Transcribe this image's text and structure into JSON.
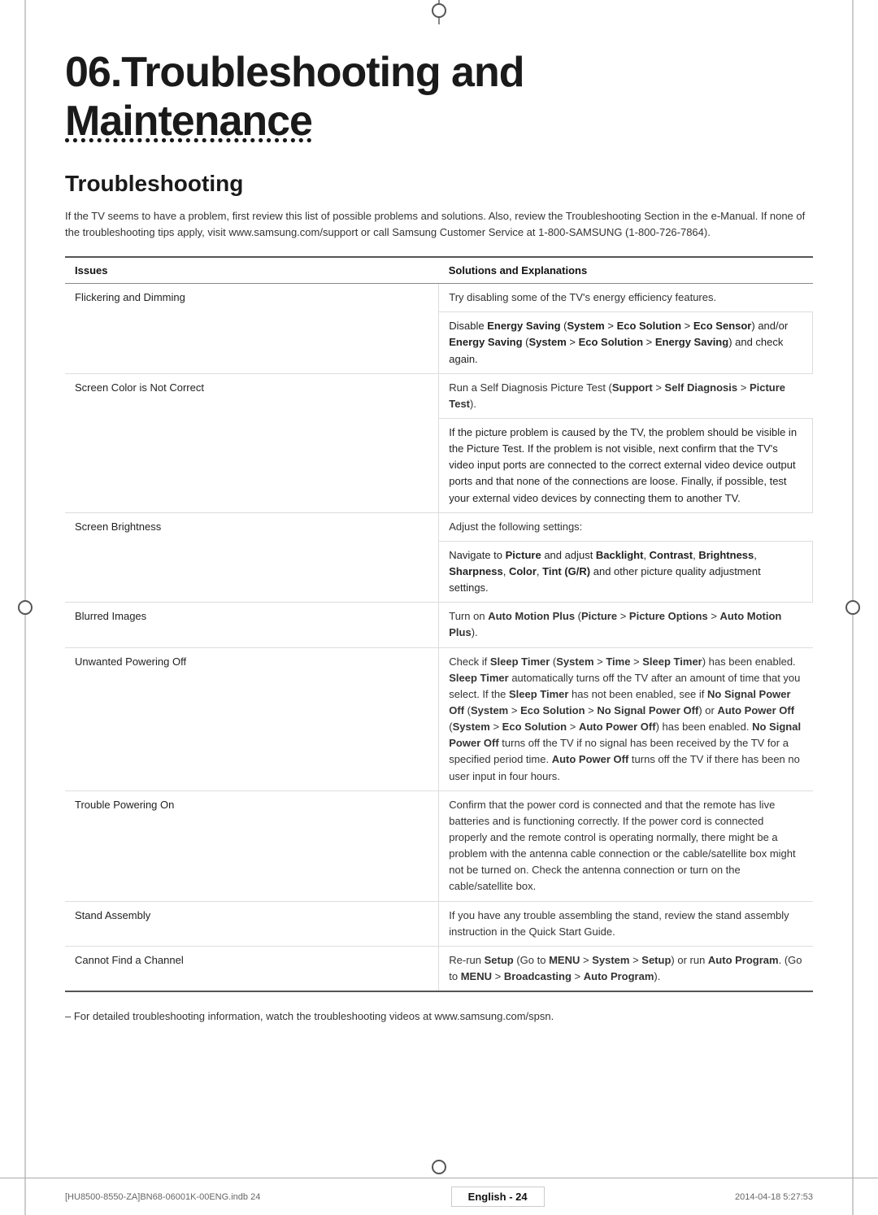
{
  "page": {
    "top_decoration": "circle",
    "left_decoration": "circle",
    "right_decoration": "circle",
    "bottom_decoration": "circle"
  },
  "header": {
    "chapter_number": "06.",
    "title_line1": "Troubleshooting and",
    "title_line2": "Maintenance"
  },
  "section": {
    "title": "Troubleshooting",
    "intro": "If the TV seems to have a problem, first review this list of possible problems and solutions. Also, review the Troubleshooting Section in the e-Manual. If none of the troubleshooting tips apply, visit www.samsung.com/support or call Samsung Customer Service at 1-800-SAMSUNG (1-800-726-7864)."
  },
  "table": {
    "col_issues": "Issues",
    "col_solutions": "Solutions and Explanations",
    "rows": [
      {
        "issue": "Flickering and Dimming",
        "solutions": [
          "Try disabling some of the TV's energy efficiency features.",
          "Disable Energy Saving (System > Eco Solution > Eco Sensor) and/or Energy Saving (System > Eco Solution > Energy Saving) and check again."
        ]
      },
      {
        "issue": "Screen Color is Not Correct",
        "solutions": [
          "Run a Self Diagnosis Picture Test (Support > Self Diagnosis > Picture Test).",
          "If the picture problem is caused by the TV, the problem should be visible in the Picture Test. If the problem is not visible, next confirm that the TV's video input ports are connected to the correct external video device output ports and that none of the connections are loose. Finally, if possible, test your external video devices by connecting them to another TV."
        ]
      },
      {
        "issue": "Screen Brightness",
        "solutions": [
          "Adjust the following settings:",
          "Navigate to Picture and adjust Backlight, Contrast, Brightness, Sharpness, Color, Tint (G/R) and other picture quality adjustment settings."
        ]
      },
      {
        "issue": "Blurred Images",
        "solutions": [
          "Turn on Auto Motion Plus (Picture > Picture Options > Auto Motion Plus)."
        ]
      },
      {
        "issue": "Unwanted Powering Off",
        "solutions": [
          "Check if Sleep Timer (System > Time > Sleep Timer) has been enabled. Sleep Timer automatically turns off the TV after an amount of time that you select. If the Sleep Timer has not been enabled, see if No Signal Power Off (System > Eco Solution > No Signal Power Off) or Auto Power Off (System > Eco Solution > Auto Power Off) has been enabled. No Signal Power Off turns off the TV if no signal has been received by the TV for a specified period time. Auto Power Off turns off the TV if there has been no user input in four hours."
        ]
      },
      {
        "issue": "Trouble Powering On",
        "solutions": [
          "Confirm that the power cord is connected and that the remote has live batteries and is functioning correctly. If the power cord is connected properly and the remote control is operating normally, there might be a problem with the antenna cable connection or the cable/satellite box might not be turned on. Check the antenna connection or turn on the cable/satellite box."
        ]
      },
      {
        "issue": "Stand Assembly",
        "solutions": [
          "If you have any trouble assembling the stand, review the stand assembly instruction in the Quick Start Guide."
        ]
      },
      {
        "issue": "Cannot Find a Channel",
        "solutions": [
          "Re-run Setup (Go to MENU > System > Setup) or run Auto Program. (Go to MENU > Broadcasting > Auto Program)."
        ]
      }
    ]
  },
  "bottom_note": "–  For detailed troubleshooting information, watch the troubleshooting videos at www.samsung.com/spsn.",
  "footer": {
    "left": "[HU8500-8550-ZA]BN68-06001K-00ENG.indb  24",
    "center": "English - 24",
    "right": "2014-04-18   5:27:53"
  }
}
